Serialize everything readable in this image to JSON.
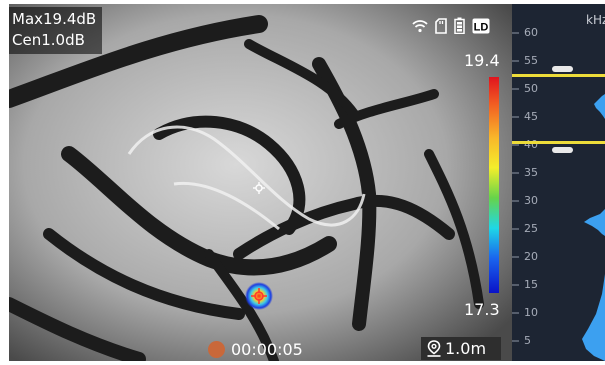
{
  "readout": {
    "max": "Max19.4dB",
    "center": "Cen1.0dB"
  },
  "status_icons": [
    "wifi-icon",
    "sd-card-icon",
    "battery-icon",
    "ld-mode-icon"
  ],
  "ld_label": "LD",
  "color_scale": {
    "max": "19.4",
    "min": "17.3"
  },
  "recording": {
    "time": "00:00:05",
    "dot_color": "#c9683a"
  },
  "distance": {
    "value": "1.0m"
  },
  "spectrum": {
    "unit": "kHz",
    "ticks": [
      "60",
      "55",
      "50",
      "45",
      "40",
      "35",
      "30",
      "25",
      "20",
      "15",
      "10",
      "5"
    ],
    "upper_cutoff": "52",
    "lower_cutoff": "41",
    "marker_color": "#eddc3a"
  }
}
